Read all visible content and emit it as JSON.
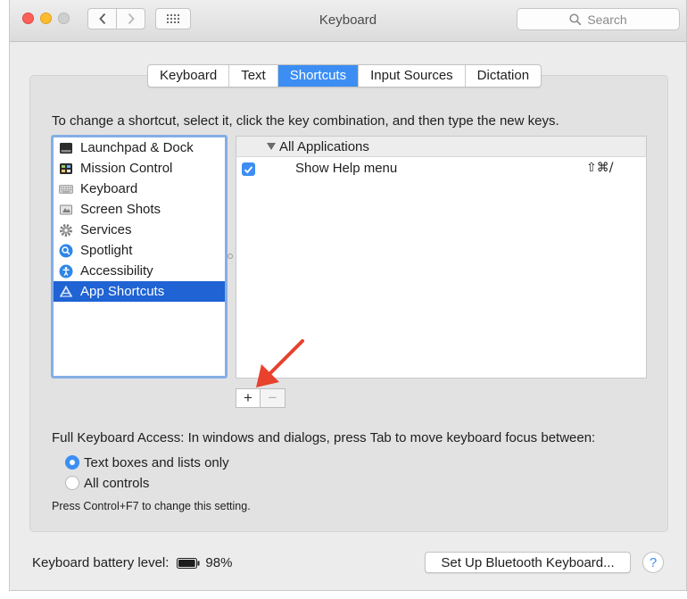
{
  "window": {
    "title": "Keyboard",
    "search_placeholder": "Search"
  },
  "tabs": [
    {
      "label": "Keyboard",
      "active": false
    },
    {
      "label": "Text",
      "active": false
    },
    {
      "label": "Shortcuts",
      "active": true
    },
    {
      "label": "Input Sources",
      "active": false
    },
    {
      "label": "Dictation",
      "active": false
    }
  ],
  "instructions": "To change a shortcut, select it, click the key combination, and then type the new keys.",
  "categories": [
    {
      "label": "Launchpad & Dock",
      "icon": "launchpad-dock-icon"
    },
    {
      "label": "Mission Control",
      "icon": "mission-control-icon"
    },
    {
      "label": "Keyboard",
      "icon": "keyboard-icon"
    },
    {
      "label": "Screen Shots",
      "icon": "screenshot-icon"
    },
    {
      "label": "Services",
      "icon": "gear-icon"
    },
    {
      "label": "Spotlight",
      "icon": "spotlight-icon"
    },
    {
      "label": "Accessibility",
      "icon": "accessibility-icon"
    },
    {
      "label": "App Shortcuts",
      "icon": "app-shortcuts-icon",
      "selected": true
    }
  ],
  "shortcuts": {
    "group_label": "All Applications",
    "items": [
      {
        "label": "Show Help menu",
        "keys": "⇧⌘/",
        "checked": true
      }
    ]
  },
  "buttons": {
    "add": "+",
    "remove": "−",
    "bluetooth": "Set Up Bluetooth Keyboard...",
    "help": "?"
  },
  "full_keyboard_access": {
    "label": "Full Keyboard Access: In windows and dialogs, press Tab to move keyboard focus between:",
    "options": [
      {
        "label": "Text boxes and lists only",
        "selected": true
      },
      {
        "label": "All controls",
        "selected": false
      }
    ],
    "hint": "Press Control+F7 to change this setting."
  },
  "battery": {
    "label": "Keyboard battery level:",
    "percent": "98%",
    "level": 0.98
  },
  "colors": {
    "accent": "#3c8ef3",
    "selection": "#1f63d4",
    "annotation_arrow": "#e8412c"
  }
}
